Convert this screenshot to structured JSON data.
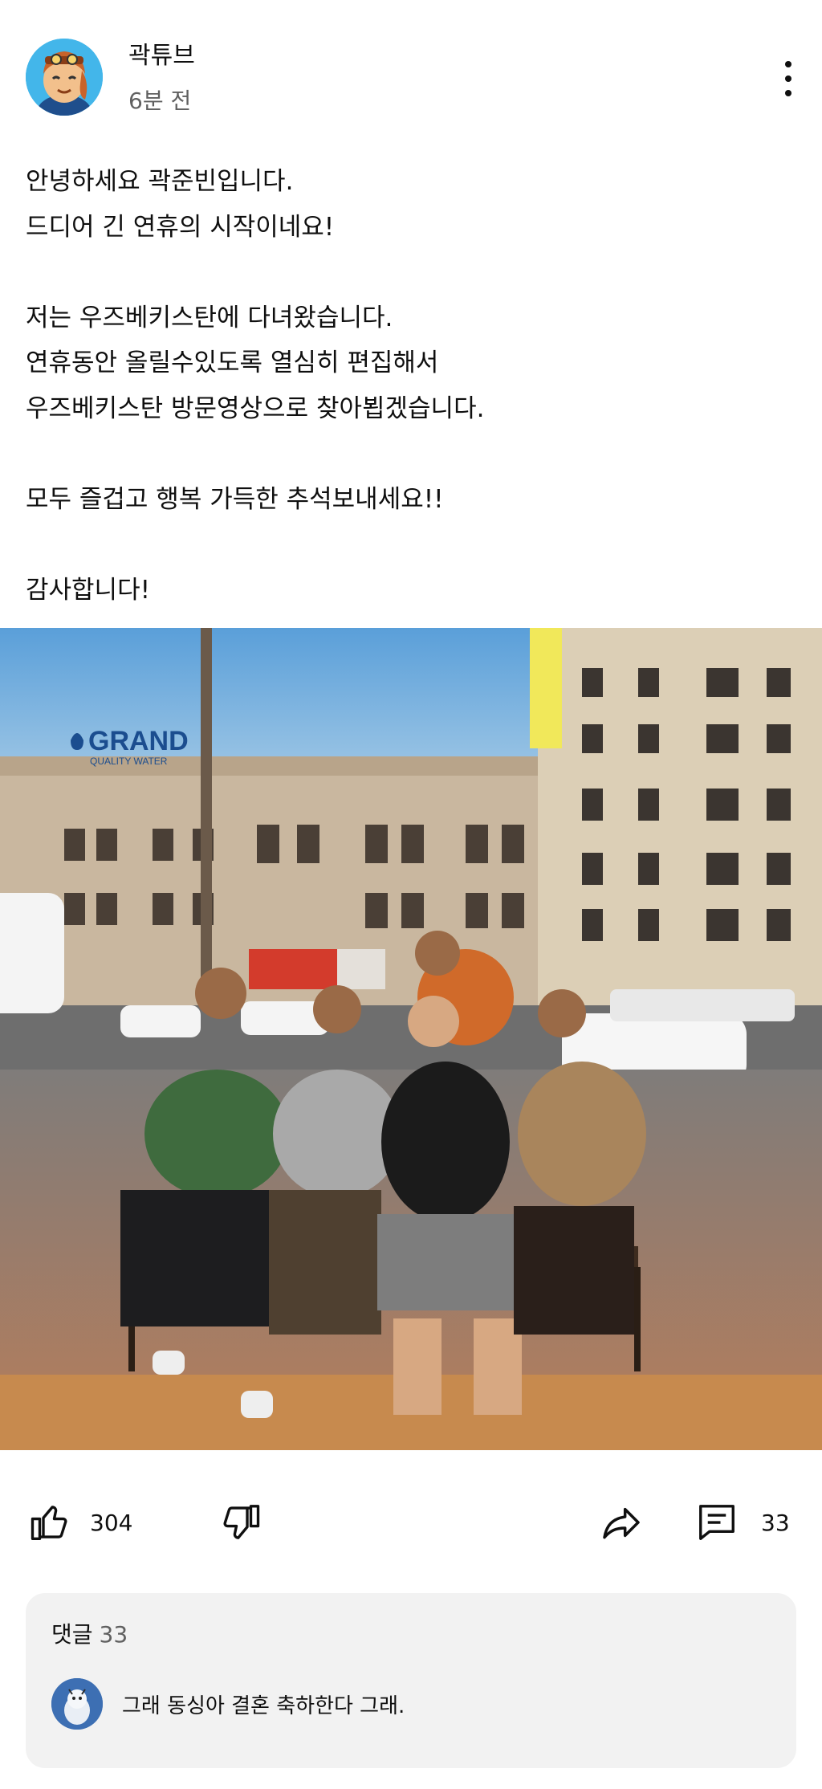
{
  "post": {
    "channel_name": "곽튜브",
    "time_ago": "6분 전",
    "body_lines": [
      "안녕하세요 곽준빈입니다.",
      "드디어 긴 연휴의 시작이네요!",
      "",
      "저는 우즈베키스탄에 다녀왔습니다.",
      "연휴동안 올릴수있도록 열심히 편집해서",
      "우즈베키스탄 방문영상으로 찾아뵙겠습니다.",
      "",
      "모두 즐겁고 행복 가득한 추석보내세요!!",
      "",
      "감사합니다!"
    ],
    "photo_sign_text": "GRAND",
    "photo_sign_subtext": "QUALITY WATER"
  },
  "actions": {
    "like_count": "304",
    "comment_count": "33"
  },
  "comments": {
    "header_label": "댓글",
    "header_count": "33",
    "top_comment": "그래 동싱아 결혼 축하한다 그래."
  },
  "icons": {
    "menu": "more-vert-icon",
    "like": "thumb-up-icon",
    "dislike": "thumb-down-icon",
    "share": "share-icon",
    "comment": "comment-icon"
  },
  "colors": {
    "avatar_bg": "#43b6ea",
    "comment_panel_bg": "#f2f2f2",
    "secondary_text": "#606060"
  }
}
